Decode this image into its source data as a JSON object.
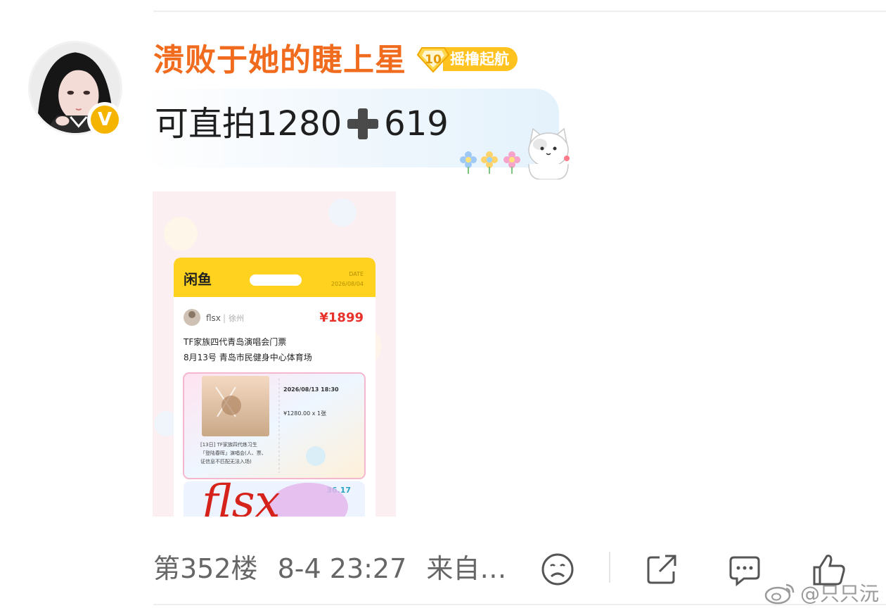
{
  "post": {
    "username": "溃败于她的睫上星",
    "level": "10",
    "badge_label": "摇橹起航",
    "comment": "可直拍1280",
    "comment_suffix": "619",
    "verified_mark": "V"
  },
  "attached_image": {
    "app_logo": "闲鱼",
    "date_label": "DATE",
    "date": "2026/08/04",
    "seller": "flsx",
    "location": "徐州",
    "price": "¥1899",
    "title_line1": "TF家族四代青岛演唱会门票",
    "title_line2": "8月13号 青岛市民健身中心体育场",
    "show_time": "2026/08/13 18:30",
    "ticket_price": "¥1280.00 x 1张",
    "ticket_desc_1": "[13日] TF家族四代练习生",
    "ticket_desc_2": "「登陆春晖」演唱会(人、票、",
    "ticket_desc_3": "证信息不匹配无法入场)",
    "partial_number": "36.17",
    "handwriting": "flsx"
  },
  "footer": {
    "floor": "第352楼",
    "time": "8-4 23:27",
    "source": "来自…"
  },
  "watermark": {
    "text": "@只只沅"
  },
  "colors": {
    "username": "#f06b1e",
    "badge": "#ffc21f",
    "xianyu_yellow": "#ffd21f",
    "price_red": "#e8312a"
  },
  "icons": [
    "verified-v-icon",
    "level-diamond-icon",
    "plus-emoji-icon",
    "sad-face-icon",
    "share-icon",
    "comment-icon",
    "thumbs-up-icon",
    "weibo-logo-icon"
  ]
}
